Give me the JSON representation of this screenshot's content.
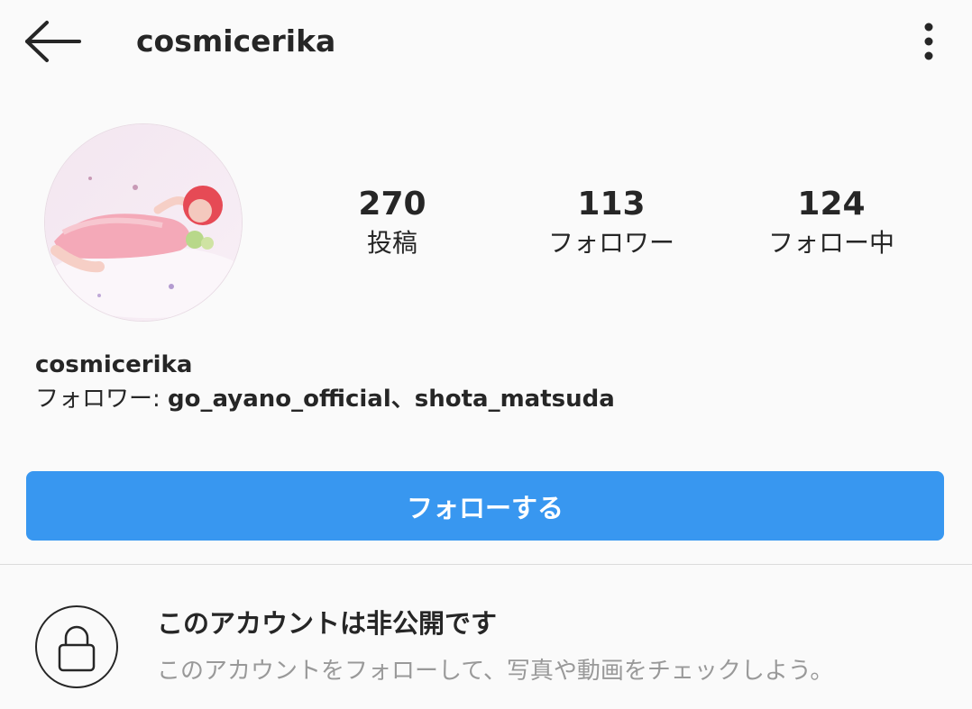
{
  "header": {
    "back_icon": "arrow-left-icon",
    "username": "cosmicerika",
    "more_icon": "vertical-dots-icon"
  },
  "profile": {
    "avatar_alt": "profile-photo",
    "stats": {
      "posts": {
        "count": "270",
        "label": "投稿"
      },
      "followers": {
        "count": "113",
        "label": "フォロワー"
      },
      "following": {
        "count": "124",
        "label": "フォロー中"
      }
    },
    "display_name": "cosmicerika",
    "followed_by_prefix": "フォロワー: ",
    "followed_by_names": "go_ayano_official、shota_matsuda"
  },
  "follow_button": {
    "label": "フォローする",
    "color": "#3897f0"
  },
  "private_notice": {
    "icon": "lock-icon",
    "title": "このアカウントは非公開です",
    "description": "このアカウントをフォローして、写真や動画をチェックしよう。"
  }
}
